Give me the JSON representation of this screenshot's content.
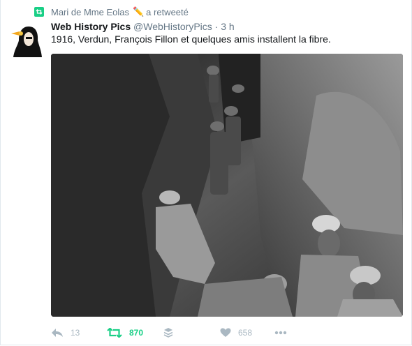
{
  "retweet": {
    "by": "Mari de Mme Eolas",
    "pencil": "✏️",
    "suffix": "a retweeté"
  },
  "tweet": {
    "name": "Web History Pics",
    "handle": "@WebHistoryPics",
    "separator": "·",
    "time": "3 h",
    "text": "1916, Verdun, François Fillon et quelques amis installent la fibre."
  },
  "actions": {
    "reply_count": "13",
    "retweet_count": "870",
    "like_count": "658"
  },
  "colors": {
    "retweet_green": "#19cf86",
    "muted": "#657786",
    "icon_grey": "#aab8c2"
  }
}
